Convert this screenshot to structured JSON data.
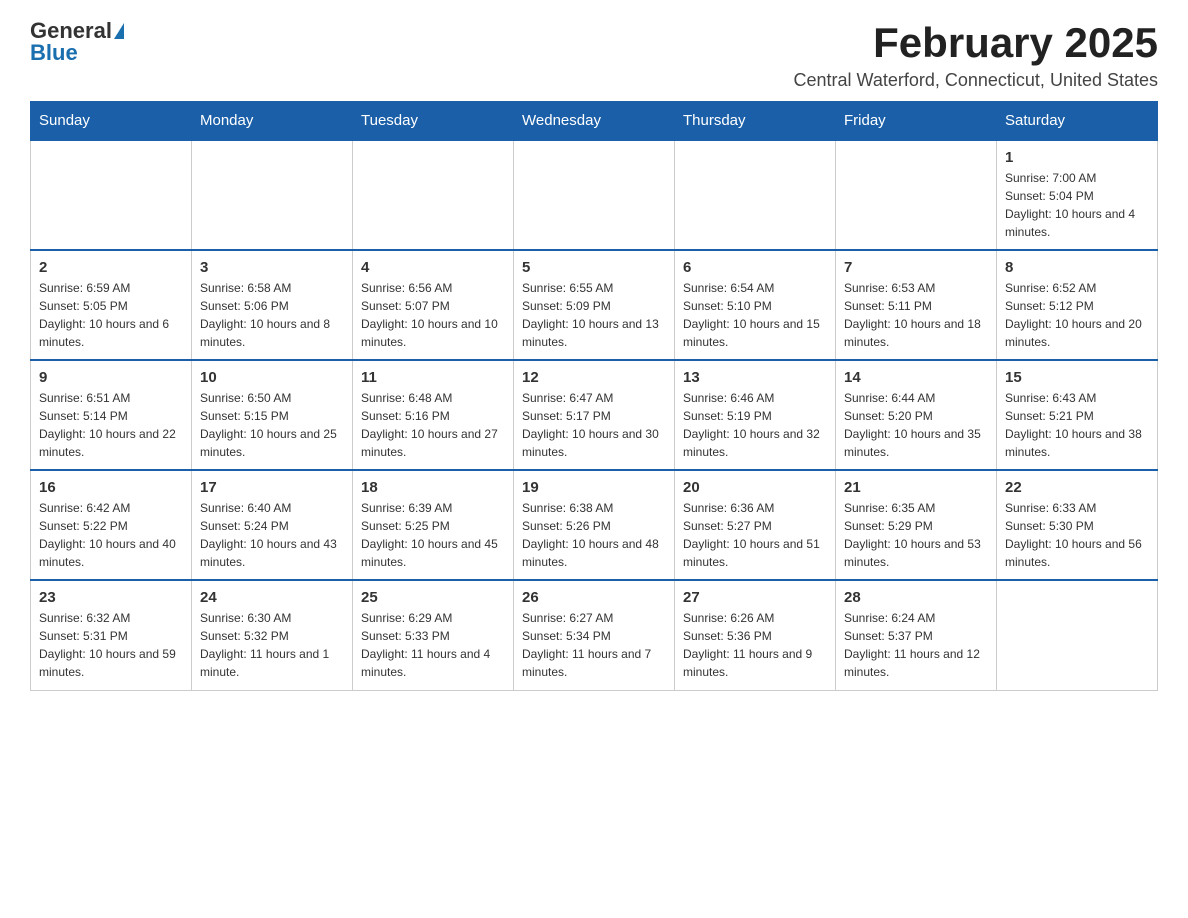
{
  "header": {
    "logo_general": "General",
    "logo_blue": "Blue",
    "month_title": "February 2025",
    "location": "Central Waterford, Connecticut, United States"
  },
  "days_of_week": [
    "Sunday",
    "Monday",
    "Tuesday",
    "Wednesday",
    "Thursday",
    "Friday",
    "Saturday"
  ],
  "weeks": [
    [
      {
        "day": "",
        "info": ""
      },
      {
        "day": "",
        "info": ""
      },
      {
        "day": "",
        "info": ""
      },
      {
        "day": "",
        "info": ""
      },
      {
        "day": "",
        "info": ""
      },
      {
        "day": "",
        "info": ""
      },
      {
        "day": "1",
        "info": "Sunrise: 7:00 AM\nSunset: 5:04 PM\nDaylight: 10 hours and 4 minutes."
      }
    ],
    [
      {
        "day": "2",
        "info": "Sunrise: 6:59 AM\nSunset: 5:05 PM\nDaylight: 10 hours and 6 minutes."
      },
      {
        "day": "3",
        "info": "Sunrise: 6:58 AM\nSunset: 5:06 PM\nDaylight: 10 hours and 8 minutes."
      },
      {
        "day": "4",
        "info": "Sunrise: 6:56 AM\nSunset: 5:07 PM\nDaylight: 10 hours and 10 minutes."
      },
      {
        "day": "5",
        "info": "Sunrise: 6:55 AM\nSunset: 5:09 PM\nDaylight: 10 hours and 13 minutes."
      },
      {
        "day": "6",
        "info": "Sunrise: 6:54 AM\nSunset: 5:10 PM\nDaylight: 10 hours and 15 minutes."
      },
      {
        "day": "7",
        "info": "Sunrise: 6:53 AM\nSunset: 5:11 PM\nDaylight: 10 hours and 18 minutes."
      },
      {
        "day": "8",
        "info": "Sunrise: 6:52 AM\nSunset: 5:12 PM\nDaylight: 10 hours and 20 minutes."
      }
    ],
    [
      {
        "day": "9",
        "info": "Sunrise: 6:51 AM\nSunset: 5:14 PM\nDaylight: 10 hours and 22 minutes."
      },
      {
        "day": "10",
        "info": "Sunrise: 6:50 AM\nSunset: 5:15 PM\nDaylight: 10 hours and 25 minutes."
      },
      {
        "day": "11",
        "info": "Sunrise: 6:48 AM\nSunset: 5:16 PM\nDaylight: 10 hours and 27 minutes."
      },
      {
        "day": "12",
        "info": "Sunrise: 6:47 AM\nSunset: 5:17 PM\nDaylight: 10 hours and 30 minutes."
      },
      {
        "day": "13",
        "info": "Sunrise: 6:46 AM\nSunset: 5:19 PM\nDaylight: 10 hours and 32 minutes."
      },
      {
        "day": "14",
        "info": "Sunrise: 6:44 AM\nSunset: 5:20 PM\nDaylight: 10 hours and 35 minutes."
      },
      {
        "day": "15",
        "info": "Sunrise: 6:43 AM\nSunset: 5:21 PM\nDaylight: 10 hours and 38 minutes."
      }
    ],
    [
      {
        "day": "16",
        "info": "Sunrise: 6:42 AM\nSunset: 5:22 PM\nDaylight: 10 hours and 40 minutes."
      },
      {
        "day": "17",
        "info": "Sunrise: 6:40 AM\nSunset: 5:24 PM\nDaylight: 10 hours and 43 minutes."
      },
      {
        "day": "18",
        "info": "Sunrise: 6:39 AM\nSunset: 5:25 PM\nDaylight: 10 hours and 45 minutes."
      },
      {
        "day": "19",
        "info": "Sunrise: 6:38 AM\nSunset: 5:26 PM\nDaylight: 10 hours and 48 minutes."
      },
      {
        "day": "20",
        "info": "Sunrise: 6:36 AM\nSunset: 5:27 PM\nDaylight: 10 hours and 51 minutes."
      },
      {
        "day": "21",
        "info": "Sunrise: 6:35 AM\nSunset: 5:29 PM\nDaylight: 10 hours and 53 minutes."
      },
      {
        "day": "22",
        "info": "Sunrise: 6:33 AM\nSunset: 5:30 PM\nDaylight: 10 hours and 56 minutes."
      }
    ],
    [
      {
        "day": "23",
        "info": "Sunrise: 6:32 AM\nSunset: 5:31 PM\nDaylight: 10 hours and 59 minutes."
      },
      {
        "day": "24",
        "info": "Sunrise: 6:30 AM\nSunset: 5:32 PM\nDaylight: 11 hours and 1 minute."
      },
      {
        "day": "25",
        "info": "Sunrise: 6:29 AM\nSunset: 5:33 PM\nDaylight: 11 hours and 4 minutes."
      },
      {
        "day": "26",
        "info": "Sunrise: 6:27 AM\nSunset: 5:34 PM\nDaylight: 11 hours and 7 minutes."
      },
      {
        "day": "27",
        "info": "Sunrise: 6:26 AM\nSunset: 5:36 PM\nDaylight: 11 hours and 9 minutes."
      },
      {
        "day": "28",
        "info": "Sunrise: 6:24 AM\nSunset: 5:37 PM\nDaylight: 11 hours and 12 minutes."
      },
      {
        "day": "",
        "info": ""
      }
    ]
  ]
}
